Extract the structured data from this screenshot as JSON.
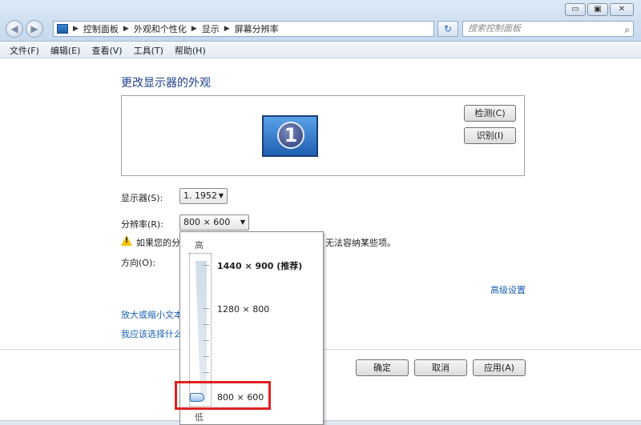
{
  "window": {
    "minimize_glyph": "▭",
    "maximize_glyph": "▣",
    "close_glyph": "✕"
  },
  "nav": {
    "back_glyph": "◀",
    "forward_glyph": "▶",
    "breadcrumb": [
      "控制面板",
      "外观和个性化",
      "显示",
      "屏幕分辨率"
    ],
    "search_placeholder": "搜索控制面板",
    "refresh_glyph": "↻",
    "search_glyph": "⌕"
  },
  "menu": [
    "文件(F)",
    "编辑(E)",
    "查看(V)",
    "工具(T)",
    "帮助(H)"
  ],
  "main": {
    "title": "更改显示器的外观",
    "monitor_number": "1",
    "detect_label": "检测(C)",
    "identify_label": "识别(I)",
    "display_label": "显示器(S):",
    "display_value": "1. 1952",
    "resolution_label": "分辨率(R):",
    "resolution_value": "800 × 600",
    "warning_prefix": "如果您的分",
    "warning_suffix": "无法容纳某些项。",
    "orientation_label": "方向(O):",
    "advanced_link": "高级设置",
    "link_enlarge": "放大或缩小文本",
    "link_help": "我应该选择什么"
  },
  "buttons": {
    "ok": "确定",
    "cancel": "取消",
    "apply": "应用(A)"
  },
  "dropdown": {
    "high_label": "高",
    "low_label": "低",
    "options": [
      "1440 × 900 (推荐)",
      "1280 × 800",
      "800 × 600"
    ],
    "selected": "800 × 600"
  },
  "colors": {
    "highlight": "#e02020",
    "link": "#1a5fb4",
    "title": "#1e3f8f"
  }
}
